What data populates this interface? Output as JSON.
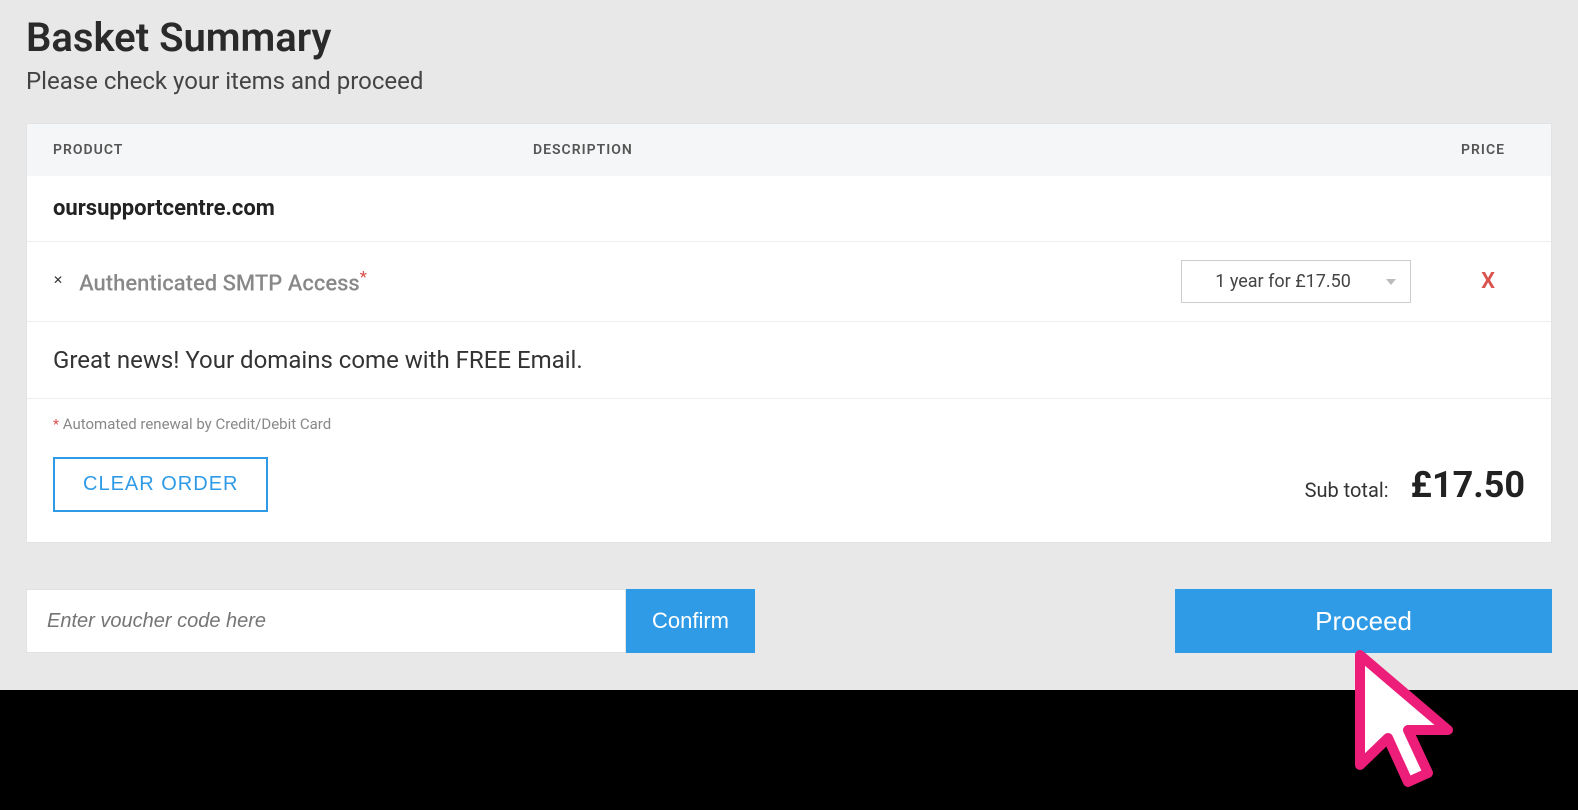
{
  "header": {
    "title": "Basket Summary",
    "subtitle": "Please check your items and proceed"
  },
  "columns": {
    "product": "PRODUCT",
    "description": "DESCRIPTION",
    "price": "PRICE"
  },
  "domain": "oursupportcentre.com",
  "item": {
    "name": "Authenticated SMTP Access",
    "term_selected": "1 year for £17.50",
    "remove_label": "X"
  },
  "news": "Great news! Your domains come with FREE Email.",
  "footnote": "Automated renewal by Credit/Debit Card",
  "clear_label": "CLEAR ORDER",
  "subtotal_label": "Sub total:",
  "subtotal_value": "£17.50",
  "voucher_placeholder": "Enter voucher code here",
  "confirm_label": "Confirm",
  "proceed_label": "Proceed"
}
